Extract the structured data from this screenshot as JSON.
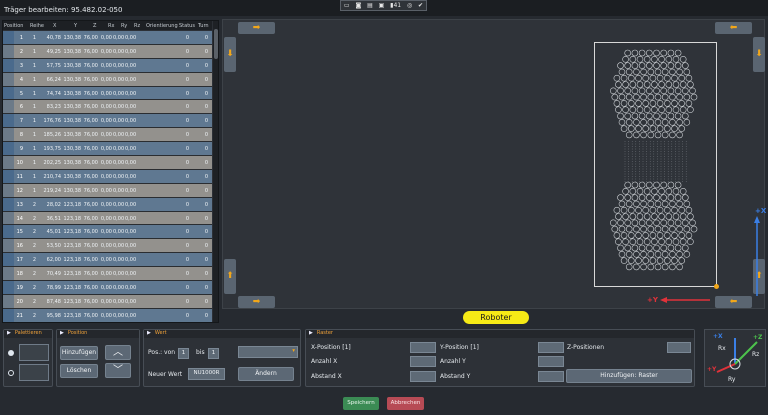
{
  "header": {
    "title": "Träger bearbeiten:  95.482.02-050",
    "status_icons": [
      "monitor-icon",
      "camera-icon",
      "network-icon",
      "display-icon",
      "speaker-icon",
      "battery-icon",
      "settings-icon",
      "check-icon"
    ],
    "battery_level": "41"
  },
  "table": {
    "columns": [
      "Position",
      "Reihe",
      "X",
      "Y",
      "Z",
      "Rx",
      "Ry",
      "Rz",
      "Orientierung",
      "Status",
      "Turn"
    ],
    "rows": [
      [
        "1",
        "1",
        "40,78",
        "130,38",
        "76,00",
        "0,00",
        "0,00",
        "0,00",
        "",
        "0",
        "0"
      ],
      [
        "2",
        "1",
        "49,25",
        "130,38",
        "76,00",
        "0,00",
        "0,00",
        "0,00",
        "",
        "0",
        "0"
      ],
      [
        "3",
        "1",
        "57,75",
        "130,38",
        "76,00",
        "0,00",
        "0,00",
        "0,00",
        "",
        "0",
        "0"
      ],
      [
        "4",
        "1",
        "66,24",
        "130,38",
        "76,00",
        "0,00",
        "0,00",
        "0,00",
        "",
        "0",
        "0"
      ],
      [
        "5",
        "1",
        "74,74",
        "130,38",
        "76,00",
        "0,00",
        "0,00",
        "0,00",
        "",
        "0",
        "0"
      ],
      [
        "6",
        "1",
        "83,23",
        "130,38",
        "76,00",
        "0,00",
        "0,00",
        "0,00",
        "",
        "0",
        "0"
      ],
      [
        "7",
        "1",
        "176,76",
        "130,38",
        "76,00",
        "0,00",
        "0,00",
        "0,00",
        "",
        "0",
        "0"
      ],
      [
        "8",
        "1",
        "185,26",
        "130,38",
        "76,00",
        "0,00",
        "0,00",
        "0,00",
        "",
        "0",
        "0"
      ],
      [
        "9",
        "1",
        "193,75",
        "130,38",
        "76,00",
        "0,00",
        "0,00",
        "0,00",
        "",
        "0",
        "0"
      ],
      [
        "10",
        "1",
        "202,25",
        "130,38",
        "76,00",
        "0,00",
        "0,00",
        "0,00",
        "",
        "0",
        "0"
      ],
      [
        "11",
        "1",
        "210,74",
        "130,38",
        "76,00",
        "0,00",
        "0,00",
        "0,00",
        "",
        "0",
        "0"
      ],
      [
        "12",
        "1",
        "219,24",
        "130,38",
        "76,00",
        "0,00",
        "0,00",
        "0,00",
        "",
        "0",
        "0"
      ],
      [
        "13",
        "2",
        "28,02",
        "123,18",
        "76,00",
        "0,00",
        "0,00",
        "0,00",
        "",
        "0",
        "0"
      ],
      [
        "14",
        "2",
        "36,51",
        "123,18",
        "76,00",
        "0,00",
        "0,00",
        "0,00",
        "",
        "0",
        "0"
      ],
      [
        "15",
        "2",
        "45,01",
        "123,18",
        "76,00",
        "0,00",
        "0,00",
        "0,00",
        "",
        "0",
        "0"
      ],
      [
        "16",
        "2",
        "53,50",
        "123,18",
        "76,00",
        "0,00",
        "0,00",
        "0,00",
        "",
        "0",
        "0"
      ],
      [
        "17",
        "2",
        "62,00",
        "123,18",
        "76,00",
        "0,00",
        "0,00",
        "0,00",
        "",
        "0",
        "0"
      ],
      [
        "18",
        "2",
        "70,49",
        "123,18",
        "76,00",
        "0,00",
        "0,00",
        "0,00",
        "",
        "0",
        "0"
      ],
      [
        "19",
        "2",
        "78,99",
        "123,18",
        "76,00",
        "0,00",
        "0,00",
        "0,00",
        "",
        "0",
        "0"
      ],
      [
        "20",
        "2",
        "87,48",
        "123,18",
        "76,00",
        "0,00",
        "0,00",
        "0,00",
        "",
        "0",
        "0"
      ],
      [
        "21",
        "2",
        "95,98",
        "123,18",
        "76,00",
        "0,00",
        "0,00",
        "0,00",
        "",
        "0",
        "0"
      ],
      [
        "22",
        "2",
        "164,02",
        "123,18",
        "76,00",
        "0,00",
        "0,00",
        "0,00",
        "",
        "0",
        "0"
      ]
    ]
  },
  "view": {
    "robot_label": "Roboter",
    "axis_x_plus": "+X",
    "axis_y_plus": "+Y",
    "arrow_color": "#f2a71a",
    "axis_red": "#e0323a",
    "axis_blue": "#3a7fe6"
  },
  "panels": {
    "palettieren": {
      "title": "Palettieren"
    },
    "position": {
      "title": "Position",
      "add": "Hinzufügen",
      "delete": "Löschen"
    },
    "wert": {
      "title": "Wert",
      "pos_label": "Pos.: von",
      "from": "1",
      "bis": "bis",
      "to": "1",
      "new_value_label": "Neuer Wert",
      "new_value": "NU1000R",
      "change": "Ändern"
    },
    "raster": {
      "title": "Raster",
      "x_pos": "X-Position [1]",
      "y_pos": "Y-Position [1]",
      "z_pos": "Z-Positionen",
      "count_x": "Anzahl X",
      "count_y": "Anzahl Y",
      "dist_x": "Abstand X",
      "dist_y": "Abstand Y",
      "add_raster": "Hinzufügen: Raster"
    }
  },
  "coord_labels": {
    "x": "+X",
    "z": "+Z",
    "y": "+Y",
    "rx": "Rx",
    "rz": "Rz",
    "ry": "Ry"
  },
  "footer": {
    "save": "Speichern",
    "cancel": "Abbrechen"
  }
}
